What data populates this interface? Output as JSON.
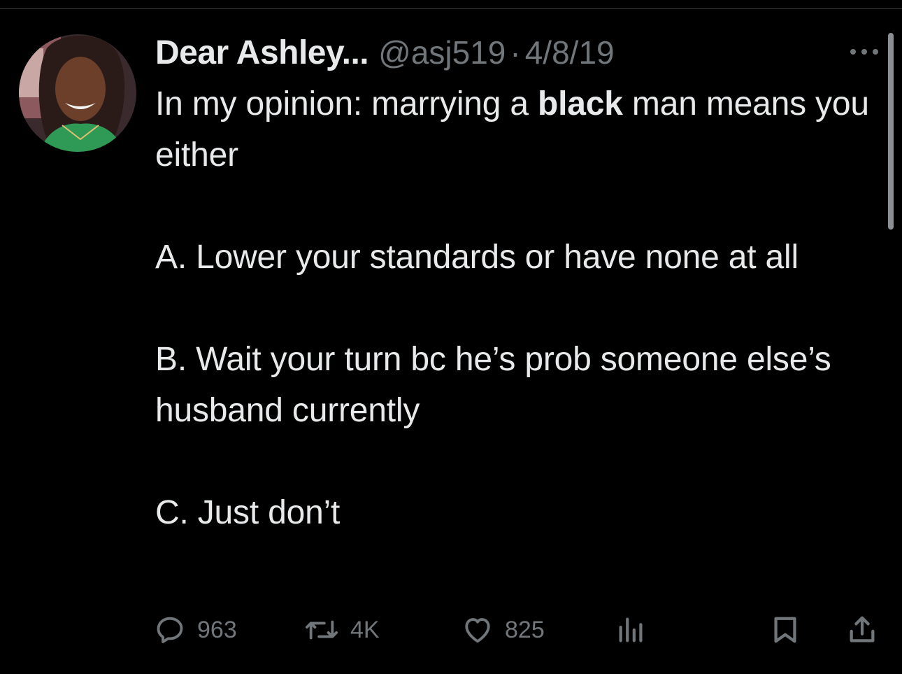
{
  "tweet": {
    "display_name": "Dear Ashley...",
    "handle": "@asj519",
    "separator": "·",
    "date": "4/8/19",
    "line1_before": "In my opinion: marrying a ",
    "line1_bold": "black",
    "line1_after": " man means you either",
    "option_a": "A. Lower your standards or have none at all",
    "option_b": "B. Wait your turn bc he’s prob someone else’s husband currently",
    "option_c": "C. Just don’t"
  },
  "actions": {
    "reply_count": "963",
    "retweet_count": "4K",
    "like_count": "825"
  },
  "icons": {
    "more": "more-horizontal-icon",
    "reply": "reply-icon",
    "retweet": "retweet-icon",
    "like": "heart-icon",
    "views": "views-chart-icon",
    "bookmark": "bookmark-icon",
    "share": "share-icon"
  },
  "colors": {
    "background": "#000000",
    "primary_text": "#e7e9ea",
    "secondary_text": "#71767b"
  }
}
